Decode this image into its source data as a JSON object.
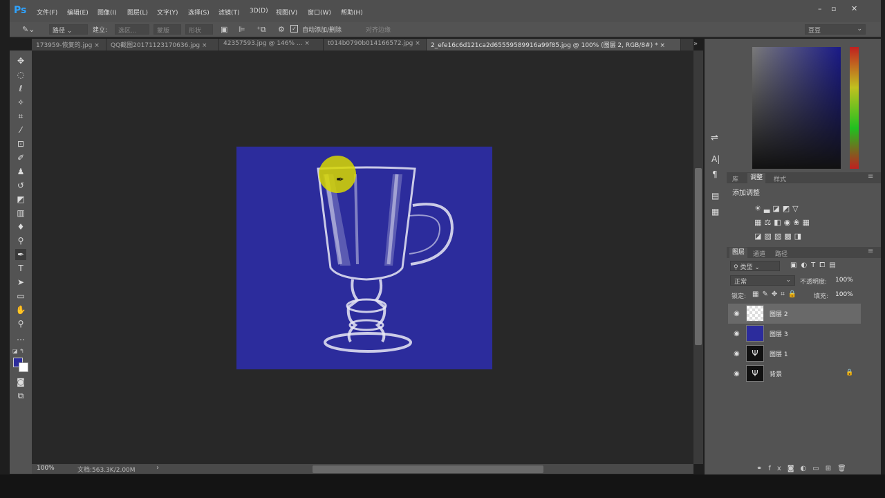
{
  "app": {
    "logo": "Ps"
  },
  "menu": [
    "文件(F)",
    "编辑(E)",
    "图像(I)",
    "图层(L)",
    "文字(Y)",
    "选择(S)",
    "滤镜(T)",
    "3D(D)",
    "视图(V)",
    "窗口(W)",
    "帮助(H)"
  ],
  "options": {
    "mode": "路径",
    "build_label": "建立:",
    "selection": "选区...",
    "mask": "蒙版",
    "shape": "形状",
    "auto_add": "自动添加/删除",
    "align_edges": "对齐边缘",
    "workspace": "豆豆"
  },
  "tabs": [
    {
      "label": "173959-恢复的.jpg",
      "close": "×"
    },
    {
      "label": "QQ截图20171123170636.jpg",
      "close": "×"
    },
    {
      "label": "42357593.jpg @ 146% ...",
      "close": "×"
    },
    {
      "label": "t014b0790b014166572.jpg",
      "close": "×"
    },
    {
      "label": "2_efe16c6d121ca2d65559589916a99f85.jpg @ 100% (图层 2, RGB/8#) *",
      "close": "×"
    }
  ],
  "status": {
    "zoom": "100%",
    "doc": "文档:563.3K/2.00M",
    "arrow": "›"
  },
  "colors": {
    "foreground": "#2c2c9c",
    "background": "#ffffff",
    "canvas": "#2c2c9c"
  },
  "panels": {
    "top_tabs": [
      "库",
      "调整",
      "样式"
    ],
    "adjust_title": "添加调整",
    "layer_tabs": [
      "图层",
      "通道",
      "路径"
    ],
    "filter_kind": "类型",
    "blend_mode": "正常",
    "opacity_label": "不透明度:",
    "opacity": "100%",
    "lock_label": "锁定:",
    "fill_label": "填充:",
    "fill": "100%"
  },
  "layers": [
    {
      "name": "图层 2",
      "selected": true
    },
    {
      "name": "图层 3",
      "selected": false
    },
    {
      "name": "图层 1",
      "selected": false
    },
    {
      "name": "背景",
      "selected": false
    }
  ]
}
